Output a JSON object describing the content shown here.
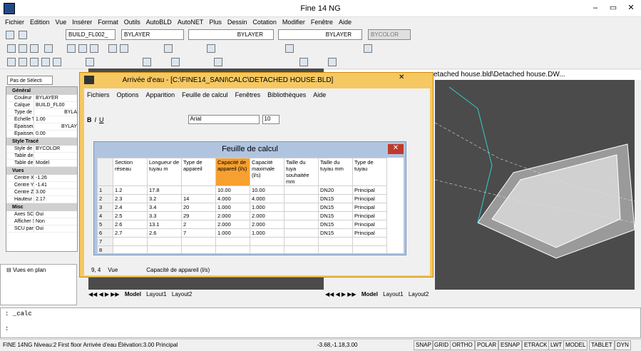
{
  "app": {
    "title": "Fine 14 NG",
    "menu": [
      "Fichier",
      "Edition",
      "Vue",
      "Insérer",
      "Format",
      "Outils",
      "AutoBLD",
      "AutoNET",
      "Plus",
      "Dessin",
      "Cotation",
      "Modifier",
      "Fenêtre",
      "Aide"
    ]
  },
  "toolbar": {
    "layer": "BUILD_FL002_",
    "color": "BYLAYER",
    "linetype": "BYLAYER",
    "lineweight": "BYLAYER",
    "plotstyle": "BYCOLOR"
  },
  "props": {
    "selector": "Pas de Sélecti",
    "sections": [
      {
        "title": "Général",
        "rows": [
          [
            "Couleur",
            "BYLAYER"
          ],
          [
            "Calque",
            "BUILD_FL00"
          ],
          [
            "Type de li",
            "BYLA"
          ],
          [
            "Échelle Ty",
            "1.00"
          ],
          [
            "Épaisseur",
            "BYLAY"
          ],
          [
            "Épaisseur",
            "0.00"
          ]
        ]
      },
      {
        "title": "Style Tracé",
        "rows": [
          [
            "Style de t",
            "BYCOLOR"
          ],
          [
            "Table des",
            ""
          ],
          [
            "Table de",
            "Model"
          ]
        ]
      },
      {
        "title": "Vues",
        "rows": [
          [
            "Centre X",
            "-1.26"
          ],
          [
            "Centre Y",
            "-1.41"
          ],
          [
            "Centre Z",
            "3.00"
          ],
          [
            "Hauteur",
            "2.17"
          ]
        ]
      },
      {
        "title": "Misc",
        "rows": [
          [
            "Axes SCU",
            "Oui"
          ],
          [
            "Afficher S",
            "Non"
          ],
          [
            "SCU par v",
            "Oui"
          ]
        ]
      }
    ]
  },
  "tree": {
    "item": "Vues en plan"
  },
  "dialog": {
    "title": "Arrivée d'eau - [C:\\FINE14_SANI\\CALC\\DETACHED HOUSE.BLD]",
    "menu": [
      "Fichiers",
      "Options",
      "Apparition",
      "Feuille de calcul",
      "Fenêtres",
      "Bibliothèques",
      "Aide"
    ],
    "font": "Arial",
    "size": "10",
    "status_cell": "9, 4",
    "status_mode": "Vue",
    "status_text": "Capacité de appareil (l/s)"
  },
  "sheet": {
    "title": "Feuille de calcul",
    "headers": [
      "Section réseau",
      "Longueur de tuyau m",
      "Type de appareil",
      "Capacité de appareil (l/s)",
      "Capacité maximale (l/s)",
      "Taille du tuya souhaitée mm",
      "Taille du tuyau mm",
      "Type de tuyau"
    ],
    "rows": [
      [
        "1",
        "1.2",
        "17.8",
        "",
        "10.00",
        "10.00",
        "",
        "DN20",
        "Principal"
      ],
      [
        "2",
        "2.3",
        "3.2",
        "14",
        "4.000",
        "4.000",
        "",
        "DN15",
        "Principal"
      ],
      [
        "3",
        "2.4",
        "3.4",
        "20",
        "1.000",
        "1.000",
        "",
        "DN15",
        "Principal"
      ],
      [
        "4",
        "2.5",
        "3.3",
        "29",
        "2.000",
        "2.000",
        "",
        "DN15",
        "Principal"
      ],
      [
        "5",
        "2.6",
        "13.1",
        "2",
        "2.000",
        "2.000",
        "",
        "DN15",
        "Principal"
      ],
      [
        "6",
        "2.7",
        "2.6",
        "7",
        "1.000",
        "1.000",
        "",
        "DN15",
        "Principal"
      ],
      [
        "7",
        "",
        "",
        "",
        "",
        "",
        "",
        "",
        ""
      ],
      [
        "8",
        "",
        "",
        "",
        "",
        "",
        "",
        "",
        ""
      ]
    ]
  },
  "views": {
    "right_title": "etached house.bld\\Detached house.DW...",
    "tabs": [
      "Model",
      "Layout1",
      "Layout2"
    ]
  },
  "command": {
    "line1": ": _calc",
    "line2": ":"
  },
  "status": {
    "text": "FINE 14NG Niveau:2 First floor Arrivée d'eau Élévation:3.00 Principal",
    "coords": "-3.68,-1.18,3.00",
    "toggles": [
      "SNAP",
      "GRID",
      "ORTHO",
      "POLAR",
      "ESNAP",
      "ETRACK",
      "LWT",
      "MODEL",
      "TABLET",
      "DYN"
    ]
  }
}
